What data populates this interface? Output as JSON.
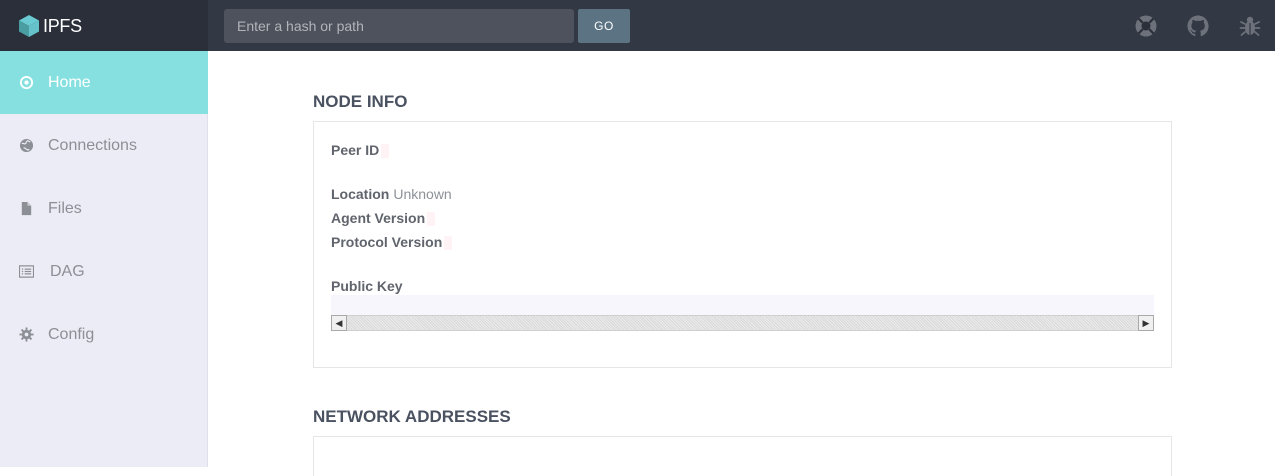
{
  "app": {
    "logo_text": "IPFS"
  },
  "header": {
    "search": {
      "placeholder": "Enter a hash or path",
      "value": ""
    },
    "go_label": "GO",
    "icons": [
      "help-lifebuoy-icon",
      "github-icon",
      "bug-icon"
    ]
  },
  "sidebar": {
    "items": [
      {
        "label": "Home",
        "icon": "home-icon",
        "active": true
      },
      {
        "label": "Connections",
        "icon": "globe-icon",
        "active": false
      },
      {
        "label": "Files",
        "icon": "file-icon",
        "active": false
      },
      {
        "label": "DAG",
        "icon": "list-icon",
        "active": false
      },
      {
        "label": "Config",
        "icon": "gear-icon",
        "active": false
      }
    ]
  },
  "node_info": {
    "title": "NODE INFO",
    "peer_id": {
      "label": "Peer ID",
      "value": ""
    },
    "location": {
      "label": "Location",
      "value": "Unknown"
    },
    "agent_version": {
      "label": "Agent Version",
      "value": ""
    },
    "protocol_version": {
      "label": "Protocol Version",
      "value": ""
    },
    "public_key": {
      "label": "Public Key",
      "value": ""
    }
  },
  "network_addresses": {
    "title": "NETWORK ADDRESSES"
  },
  "colors": {
    "topbar": "#2a2f3a",
    "accent_active": "#86e0e0",
    "sidebar_bg": "#ececf6",
    "go_button": "#5b7383"
  }
}
